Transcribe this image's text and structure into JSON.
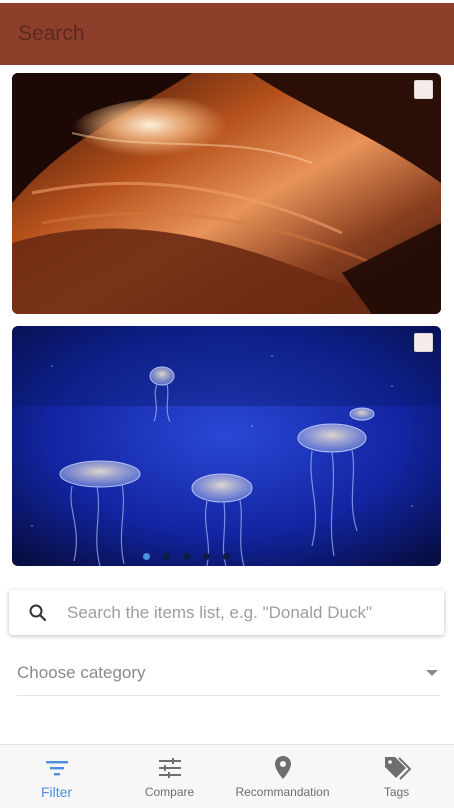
{
  "appbar": {
    "title": "Search"
  },
  "carousel": {
    "slides": [
      {
        "image_alt": "Antelope canyon sandstone",
        "selected": false
      },
      {
        "image_alt": "Jellyfish in deep blue water",
        "selected": false
      }
    ],
    "dot_count": 5,
    "active_dot": 1
  },
  "search": {
    "placeholder": "Search the items list, e.g. \"Donald Duck\"",
    "value": ""
  },
  "category": {
    "label": "Choose category"
  },
  "bottom_nav": {
    "items": [
      {
        "label": "Filter",
        "icon": "filter-icon",
        "active": true
      },
      {
        "label": "Compare",
        "icon": "sliders-icon",
        "active": false
      },
      {
        "label": "Recommandation",
        "icon": "map-pin-icon",
        "active": false
      },
      {
        "label": "Tags",
        "icon": "tags-icon",
        "active": false
      }
    ]
  },
  "colors": {
    "appbar": "#8e3f2c",
    "accent": "#4a8fe0",
    "icon_gray": "#6e6e6e"
  }
}
